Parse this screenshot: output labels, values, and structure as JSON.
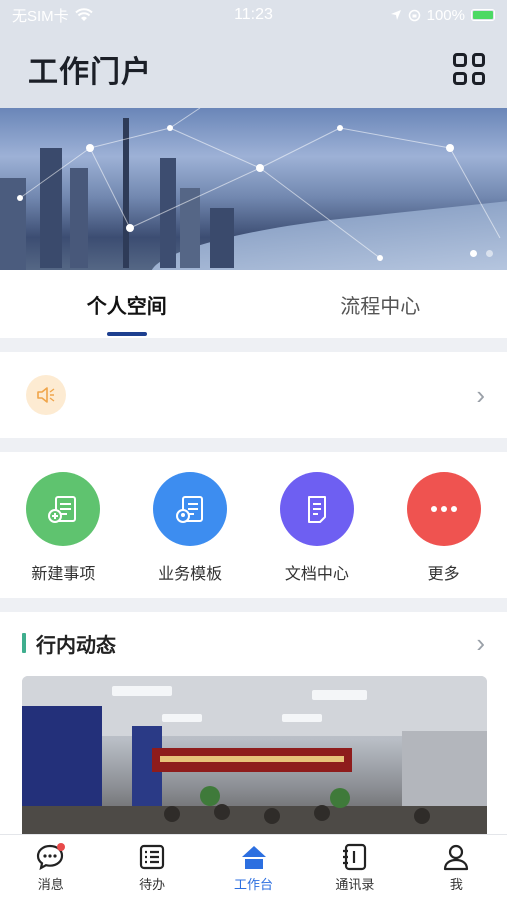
{
  "status": {
    "carrier": "无SIM卡",
    "time": "11:23",
    "battery": "100%"
  },
  "header": {
    "title": "工作门户",
    "apps_icon": "grid-icon"
  },
  "banner": {
    "page_count": 2,
    "active_page": 1
  },
  "tabs": [
    {
      "label": "个人空间",
      "active": true
    },
    {
      "label": "流程中心",
      "active": false
    }
  ],
  "notice": {
    "icon": "speaker-icon",
    "chevron": "chevron-right-icon"
  },
  "quick_actions": [
    {
      "label": "新建事项",
      "color": "#5fc36f",
      "icon": "new-item-icon"
    },
    {
      "label": "业务模板",
      "color": "#3d8df0",
      "icon": "template-icon"
    },
    {
      "label": "文档中心",
      "color": "#6e5ff2",
      "icon": "document-icon"
    },
    {
      "label": "更多",
      "color": "#ef5350",
      "icon": "more-icon"
    }
  ],
  "news": {
    "title": "行内动态",
    "accent": "#3fae8e"
  },
  "tabbar": [
    {
      "label": "消息",
      "icon": "message-icon",
      "active": false,
      "badge": true
    },
    {
      "label": "待办",
      "icon": "todo-icon",
      "active": false
    },
    {
      "label": "工作台",
      "icon": "workbench-icon",
      "active": true
    },
    {
      "label": "通讯录",
      "icon": "contacts-icon",
      "active": false
    },
    {
      "label": "我",
      "icon": "user-icon",
      "active": false
    }
  ],
  "colors": {
    "active": "#2c6fe0",
    "tab_underline": "#1d3f8f",
    "header_bg": "#dde2ea"
  }
}
